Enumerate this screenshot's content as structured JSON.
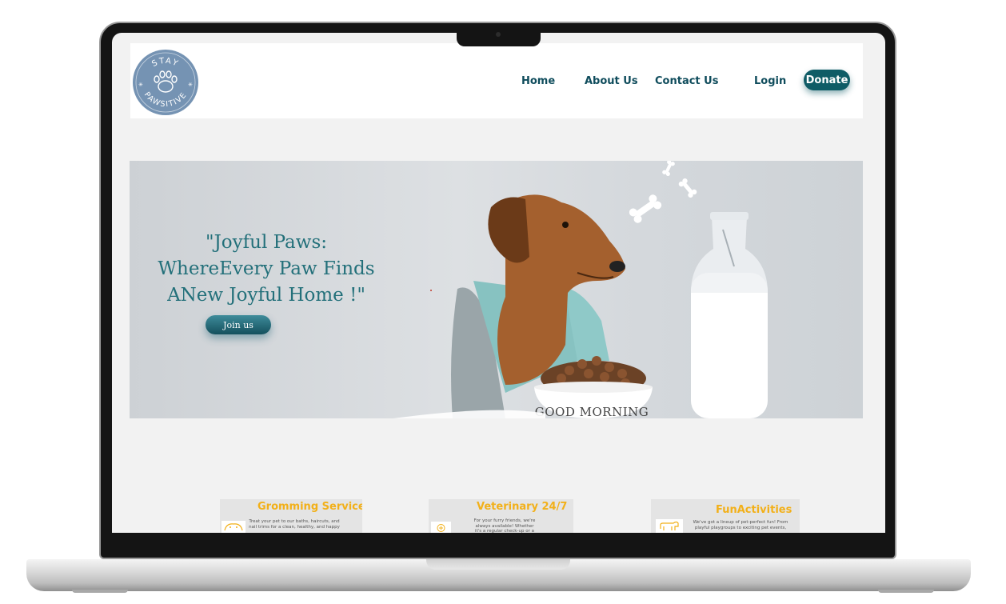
{
  "logo": {
    "top_text": "STAY",
    "bottom_text": "PAWSITIVE"
  },
  "nav": {
    "home": "Home",
    "about": "About Us",
    "contact": "Contact Us",
    "login": "Login",
    "donate": "Donate"
  },
  "hero": {
    "title_line1": "\"Joyful Paws:",
    "title_line2": "WhereEvery Paw Finds",
    "title_line3": "ANew Joyful Home !\"",
    "cta": "Join us",
    "bowl_text": "GOOD MORNING"
  },
  "services": [
    {
      "title": "Gromming Services",
      "text": "Treat your pet to our baths, haircuts, and nail trims for a clean, healthy, and happy",
      "icon": "grooming-icon"
    },
    {
      "title": "Veterinary 24/7",
      "text": "For your furry friends, we're always available! Whether it's a regular check-up or a pet emergency, our",
      "icon": "vet-icon"
    },
    {
      "title": "FunActivities",
      "text": "We've got a lineup of pet-perfect fun! From playful playgroups to exciting pet events,",
      "icon": "dog-icon"
    }
  ],
  "colors": {
    "brand_teal": "#0f5c66",
    "headline_teal": "#23707a",
    "service_yellow": "#f2b019",
    "logo_blue": "#7593b3"
  }
}
